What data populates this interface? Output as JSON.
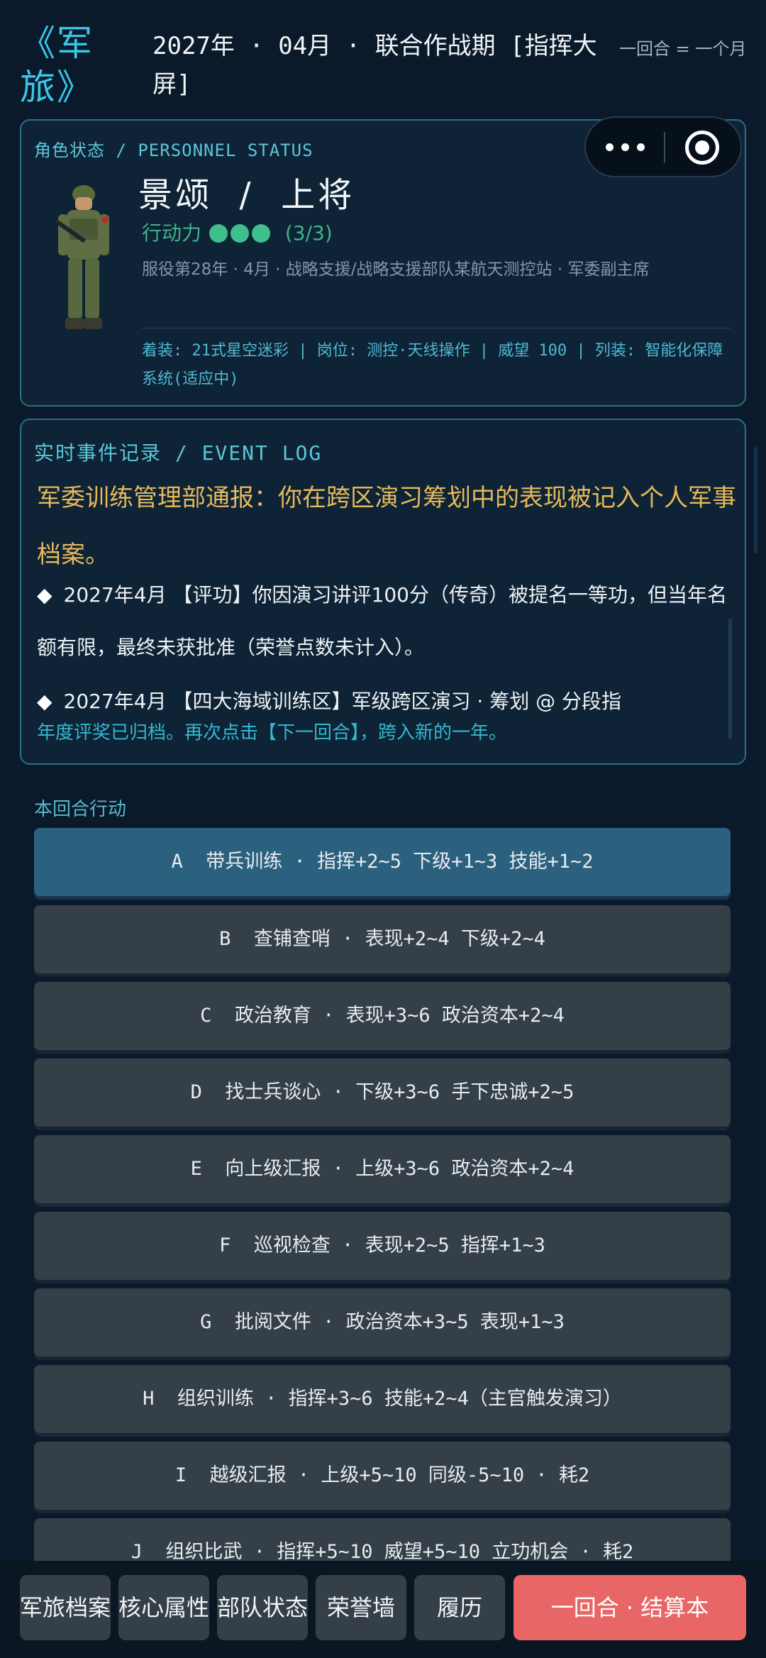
{
  "header": {
    "brand": "《军旅》",
    "date_line": "2027年 · 04月 · 联合作战期 [指挥大屏]",
    "turn_note": "一回合 = 一个月"
  },
  "status": {
    "tag": "角色状态 / PERSONNEL STATUS",
    "name_rank": "景颂  /  上将",
    "ap_label": "行动力",
    "ap_current": 3,
    "ap_max": 3,
    "ap_count": "(3/3)",
    "service": "服役第28年 · 4月 · 战略支援/战略支援部队某航天测控站 · 军委副主席",
    "equipment": "着装: 21式星空迷彩 | 岗位: 测控·天线操作 | 威望 100 | 列装: 智能化保障系统(适应中)"
  },
  "event_log": {
    "tag": "实时事件记录 / EVENT LOG",
    "headline": "军委训练管理部通报：你在跨区演习筹划中的表现被记入个人军事档案。",
    "items": [
      "2027年4月 【评功】你因演习讲评100分（传奇）被提名一等功，但当年名额有限，最终未获批准（荣誉点数未计入）。",
      "2027年4月 【四大海域训练区】军级跨区演习 · 筹划 @ 分段指"
    ],
    "footer": "年度评奖已归档。再次点击【下一回合】，跨入新的一年。"
  },
  "actions": {
    "label": "本回合行动",
    "items": [
      {
        "key": "A",
        "text": "A  带兵训练 · 指挥+2~5 下级+1~3 技能+1~2"
      },
      {
        "key": "B",
        "text": "B  查铺查哨 · 表现+2~4 下级+2~4"
      },
      {
        "key": "C",
        "text": "C  政治教育 · 表现+3~6 政治资本+2~4"
      },
      {
        "key": "D",
        "text": "D  找士兵谈心 · 下级+3~6 手下忠诚+2~5"
      },
      {
        "key": "E",
        "text": "E  向上级汇报 · 上级+3~6 政治资本+2~4"
      },
      {
        "key": "F",
        "text": "F  巡视检查 · 表现+2~5 指挥+1~3"
      },
      {
        "key": "G",
        "text": "G  批阅文件 · 政治资本+3~5 表现+1~3"
      },
      {
        "key": "H",
        "text": "H  组织训练 · 指挥+3~6 技能+2~4（主官触发演习）"
      },
      {
        "key": "I",
        "text": "I  越级汇报 · 上级+5~10 同级-5~10 · 耗2"
      },
      {
        "key": "J",
        "text": "J  组织比武 · 指挥+5~10 威望+5~10 立功机会 · 耗2"
      }
    ]
  },
  "nav": {
    "archive": "军旅档案",
    "core": "核心属性",
    "unit": "部队状态",
    "honor": "荣誉墙",
    "resume": "履历",
    "next": "一回合 · 结算本"
  },
  "colors": {
    "accent": "#38c7e6",
    "headline": "#e6b95a",
    "active_action": "#2b617f",
    "primary_button": "#e86666"
  }
}
